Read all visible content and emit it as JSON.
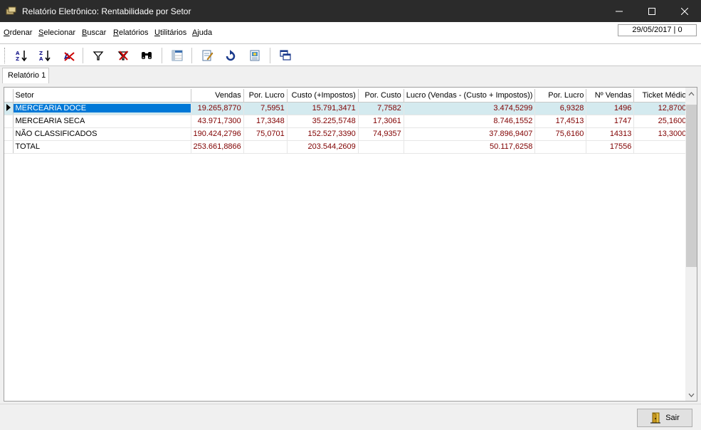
{
  "window": {
    "title": "Relatório Eletrônico: Rentabilidade por Setor"
  },
  "menu": {
    "items": [
      {
        "first": "O",
        "rest": "rdenar"
      },
      {
        "first": "S",
        "rest": "elecionar"
      },
      {
        "first": "B",
        "rest": "uscar"
      },
      {
        "first": "R",
        "rest": "elatórios"
      },
      {
        "first": "U",
        "rest": "tilitários"
      },
      {
        "first": "A",
        "rest": "juda"
      }
    ]
  },
  "status": {
    "date": "29/05/2017 | 0"
  },
  "tabs": [
    {
      "label": "Relatório 1"
    }
  ],
  "grid": {
    "columns": [
      "Setor",
      "Vendas",
      "Por. Lucro",
      "Custo (+Impostos)",
      "Por. Custo",
      "Lucro (Vendas - (Custo + Impostos))",
      "Por. Lucro",
      "Nº Vendas",
      "Ticket Médio"
    ],
    "rows": [
      [
        "MERCEARIA DOCE",
        "19.265,8770",
        "7,5951",
        "15.791,3471",
        "7,7582",
        "3.474,5299",
        "6,9328",
        "1496",
        "12,8700"
      ],
      [
        "MERCEARIA SECA",
        "43.971,7300",
        "17,3348",
        "35.225,5748",
        "17,3061",
        "8.746,1552",
        "17,4513",
        "1747",
        "25,1600"
      ],
      [
        "NÃO CLASSIFICADOS",
        "190.424,2796",
        "75,0701",
        "152.527,3390",
        "74,9357",
        "37.896,9407",
        "75,6160",
        "14313",
        "13,3000"
      ],
      [
        "TOTAL",
        "253.661,8866",
        "",
        "203.544,2609",
        "",
        "50.117,6258",
        "",
        "17556",
        ""
      ]
    ]
  },
  "footer": {
    "exit_label": "Sair"
  },
  "colors": {
    "titlebar": "#2b2b2b",
    "selection": "#0078d7",
    "selected_row": "#d4eaef",
    "value_text": "#800000"
  }
}
